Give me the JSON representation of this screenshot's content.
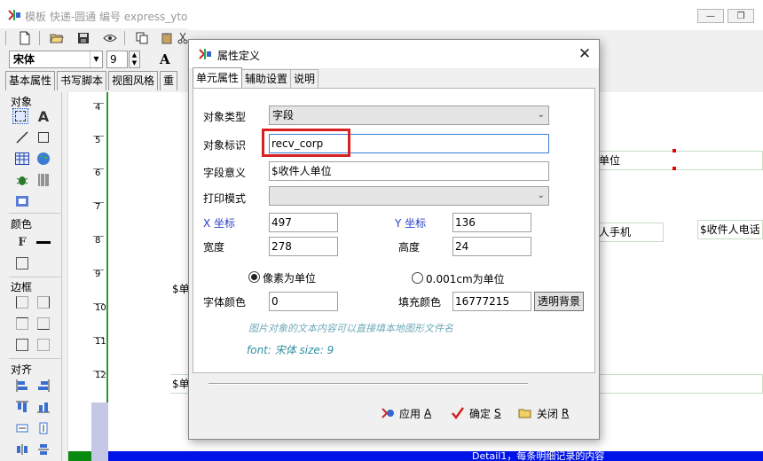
{
  "window": {
    "title": "模板 快递-圆通 编号 express_yto",
    "min_label": "—",
    "restore_label": "❐"
  },
  "toolbar": {
    "font_name": "宋体",
    "font_size": "9",
    "bold_glyph": "A"
  },
  "main_tabs": [
    "基本属性",
    "书写脚本",
    "视图风格",
    "重"
  ],
  "palette": {
    "objects_label": "对象",
    "color_label": "颜色",
    "border_label": "边框",
    "align_label": "对齐",
    "text_tool": "A",
    "font_tool": "F"
  },
  "ruler": {
    "marks": [
      "4",
      "5",
      "6",
      "7",
      "8",
      "9",
      "10",
      "11",
      "12"
    ]
  },
  "canvas": {
    "fields": [
      {
        "text": "单位"
      },
      {
        "text": "人手机"
      },
      {
        "text": "$收件人电话"
      },
      {
        "text": "$单"
      },
      {
        "text": "$单"
      }
    ],
    "detail_text": "Detail1，每条明细记录的内容"
  },
  "dialog": {
    "title": "属性定义",
    "close_glyph": "✕",
    "tabs": [
      {
        "label": "单元属性",
        "active": true
      },
      {
        "label": "辅助设置",
        "active": false
      },
      {
        "label": "说明",
        "active": false
      }
    ],
    "object_type_label": "对象类型",
    "object_type_value": "字段",
    "object_id_label": "对象标识",
    "object_id_value": "recv_corp",
    "field_meaning_label": "字段意义",
    "field_meaning_value": "$收件人单位",
    "print_mode_label": "打印模式",
    "print_mode_value": "",
    "x_label": "X 坐标",
    "x_value": "497",
    "y_label": "Y 坐标",
    "y_value": "136",
    "width_label": "宽度",
    "width_value": "278",
    "height_label": "高度",
    "height_value": "24",
    "unit_pixel_label": "像素为单位",
    "unit_cm_label": "0.001cm为单位",
    "unit_selected": "pixel",
    "font_color_label": "字体颜色",
    "font_color_value": "0",
    "fill_color_label": "填充颜色",
    "fill_color_value": "16777215",
    "transparent_label": "透明背景",
    "hint_text": "图片对象的文本内容可以直接填本地图形文件名",
    "font_info": "font:  宋体   size:  9",
    "apply_label": "应用",
    "apply_key": "A",
    "ok_label": "确定",
    "ok_key": "S",
    "close_label": "关闭",
    "close_key": "R"
  }
}
